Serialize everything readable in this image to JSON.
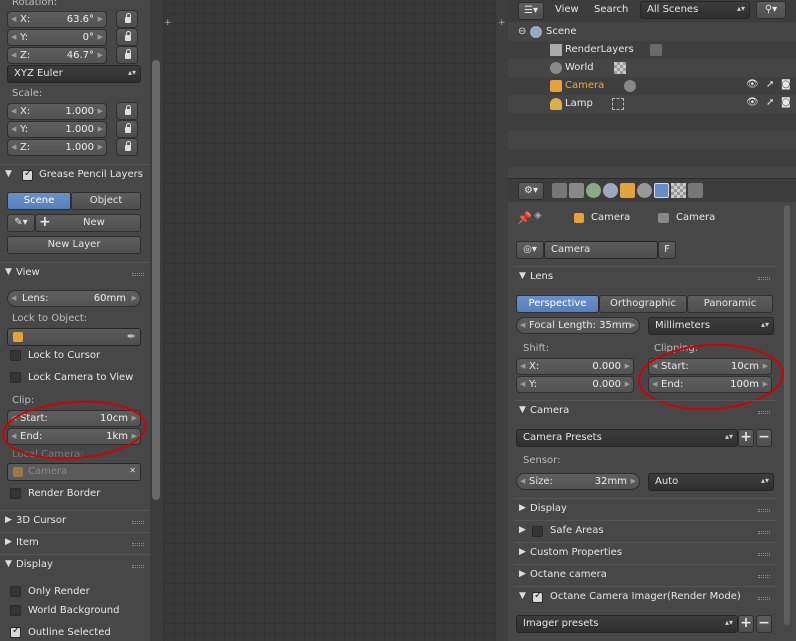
{
  "left": {
    "rotation": {
      "label": "Rotation:",
      "x": "63.6°",
      "y": "0°",
      "z": "46.7°",
      "x_key": "X:",
      "y_key": "Y:",
      "z_key": "Z:"
    },
    "rotation_mode": "XYZ Euler",
    "scale": {
      "label": "Scale:",
      "x": "1.000",
      "y": "1.000",
      "z": "1.000",
      "x_key": "X:",
      "y_key": "Y:",
      "z_key": "Z:"
    },
    "grease": {
      "title": "Grease Pencil Layers",
      "scene_tab": "Scene",
      "object_tab": "Object",
      "new": "New",
      "new_layer": "New Layer"
    },
    "view": {
      "title": "View",
      "lens_key": "Lens:",
      "lens_val": "60mm",
      "lock_to_object": "Lock to Object:",
      "lock_to_cursor": "Lock to Cursor",
      "lock_camera": "Lock Camera to View",
      "clip": "Clip:",
      "start_key": "Start:",
      "start_val": "10cm",
      "end_key": "End:",
      "end_val": "1km",
      "local_camera": "Local Camera:",
      "camera_name": "Camera",
      "render_border": "Render Border"
    },
    "cursor3d": "3D Cursor",
    "item": "Item",
    "display": {
      "title": "Display",
      "only_render": "Only Render",
      "world_bg": "World Background",
      "outline": "Outline Selected"
    }
  },
  "outliner": {
    "menu_view": "View",
    "menu_search": "Search",
    "scenes": "All Scenes",
    "rows": [
      "Scene",
      "RenderLayers",
      "World",
      "Camera",
      "Lamp"
    ]
  },
  "props": {
    "path_a": "Camera",
    "path_b": "Camera",
    "datablock": "Camera",
    "fake": "F",
    "lens": {
      "title": "Lens",
      "tabs": [
        "Perspective",
        "Orthographic",
        "Panoramic"
      ],
      "focal": "Focal Length: 35mm",
      "unit": "Millimeters",
      "shift": "Shift:",
      "shift_x_key": "X:",
      "shift_x": "0.000",
      "shift_y_key": "Y:",
      "shift_y": "0.000",
      "clipping": "Clipping:",
      "start_key": "Start:",
      "start": "10cm",
      "end_key": "End:",
      "end": "100m"
    },
    "camera": {
      "title": "Camera",
      "presets": "Camera Presets",
      "sensor": "Sensor:",
      "size_key": "Size:",
      "size": "32mm",
      "fit": "Auto"
    },
    "panels": [
      "Display",
      "Safe Areas",
      "Custom Properties",
      "Octane camera",
      "Octane Camera Imager(Render Mode)"
    ],
    "imager_presets": "Imager presets"
  },
  "colors": {
    "accent": "#5680bd",
    "annotation": "#d40000"
  }
}
